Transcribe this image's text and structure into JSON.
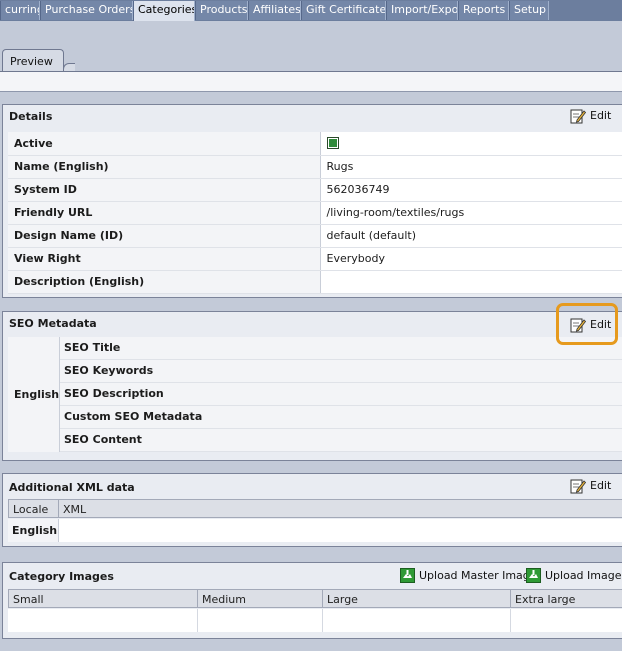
{
  "topnav": {
    "tabs": [
      {
        "label": "curring",
        "active": false
      },
      {
        "label": "Purchase Orders",
        "active": false
      },
      {
        "label": "Categories",
        "active": true
      },
      {
        "label": "Products",
        "active": false
      },
      {
        "label": "Affiliates",
        "active": false
      },
      {
        "label": "Gift Certificates",
        "active": false
      },
      {
        "label": "Import/Export",
        "active": false
      },
      {
        "label": "Reports",
        "active": false
      },
      {
        "label": "Setup",
        "active": false
      }
    ]
  },
  "subtab": {
    "label": "Preview"
  },
  "details": {
    "title": "Details",
    "edit_label": "Edit",
    "rows": [
      {
        "label": "Active",
        "value": "",
        "checked": true
      },
      {
        "label": "Name (English)",
        "value": "Rugs"
      },
      {
        "label": "System ID",
        "value": "562036749"
      },
      {
        "label": "Friendly URL",
        "value": "/living-room/textiles/rugs"
      },
      {
        "label": "Design Name (ID)",
        "value": "default (default)"
      },
      {
        "label": "View Right",
        "value": "Everybody"
      },
      {
        "label": "Description (English)",
        "value": ""
      }
    ]
  },
  "seo": {
    "title": "SEO Metadata",
    "edit_label": "Edit",
    "language": "English",
    "fields": [
      "SEO Title",
      "SEO Keywords",
      "SEO Description",
      "Custom SEO Metadata",
      "SEO Content"
    ]
  },
  "xml": {
    "title": "Additional XML data",
    "edit_label": "Edit",
    "columns": [
      "Locale",
      "XML"
    ],
    "rows": [
      {
        "locale": "English",
        "xml": ""
      }
    ]
  },
  "images": {
    "title": "Category Images",
    "upload_master_label": "Upload Master Image",
    "upload_images_label": "Upload Images p",
    "columns": [
      "Small",
      "Medium",
      "Large",
      "Extra large"
    ]
  },
  "colors": {
    "nav_bg": "#6c7e9e",
    "highlight": "#e69a1e",
    "panel_bg": "#e9ecf2"
  }
}
